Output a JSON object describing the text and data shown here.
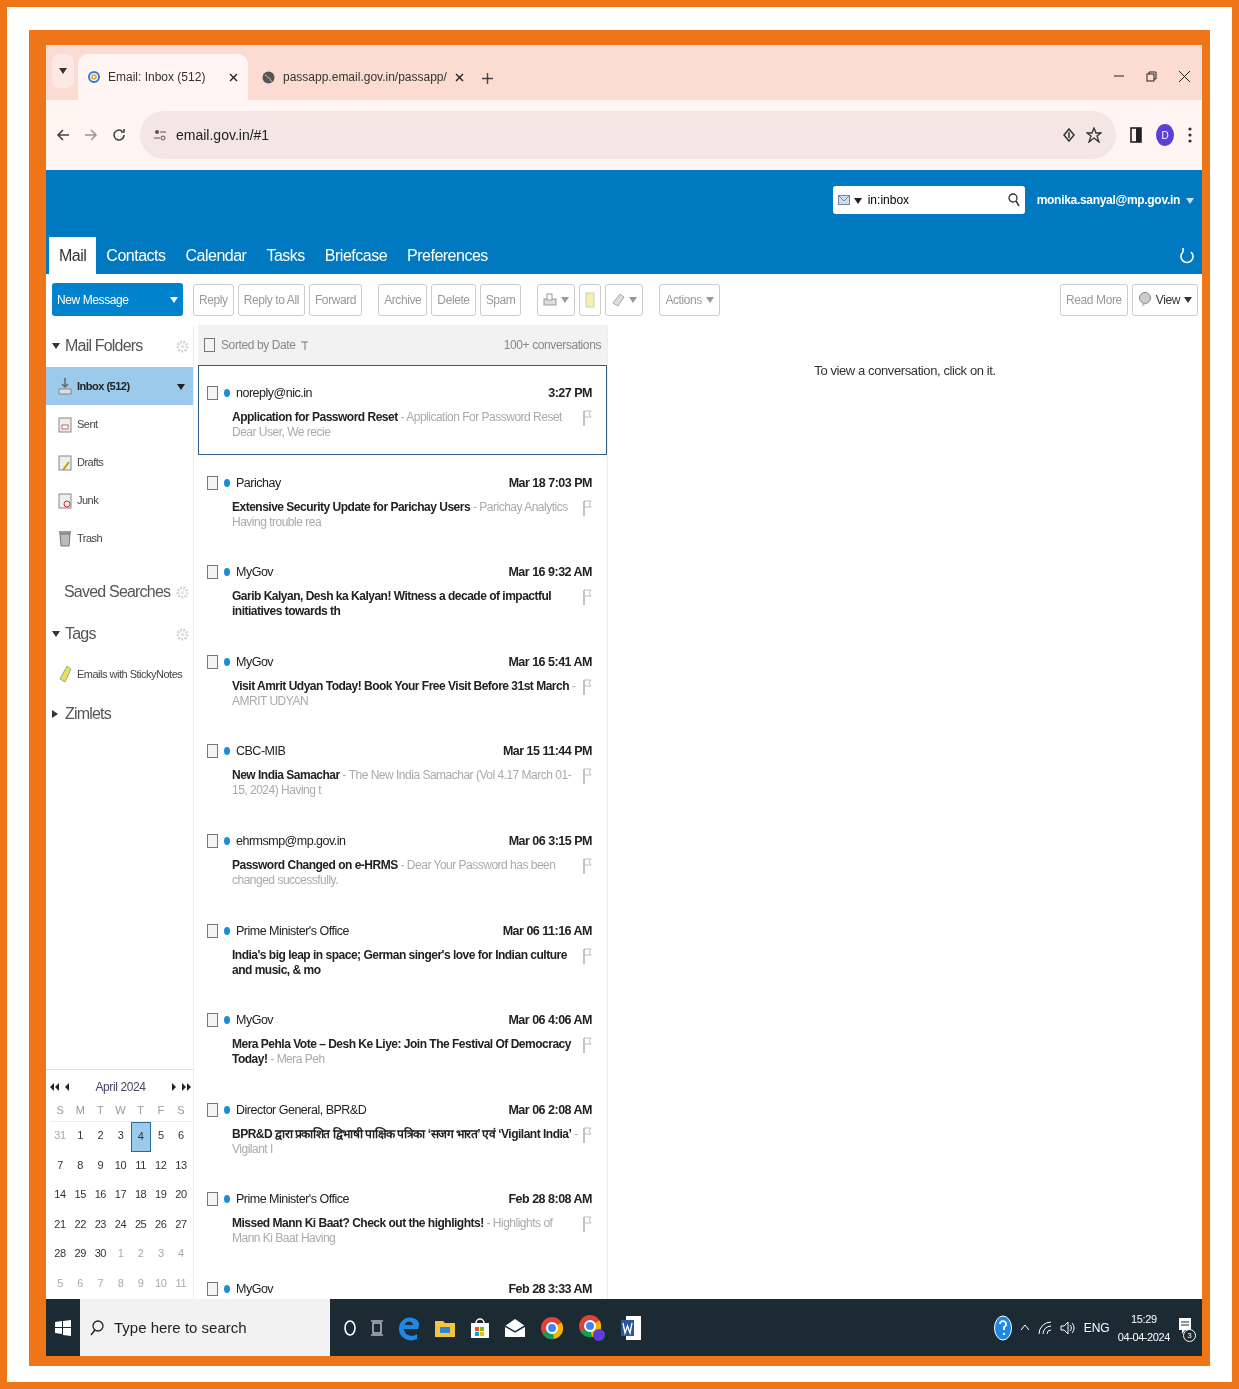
{
  "browser": {
    "tabs": [
      {
        "title": "Email: Inbox (512)",
        "selected": true
      },
      {
        "title": "passapp.email.gov.in/passapp/",
        "selected": false
      }
    ],
    "address": "email.gov.in/#1",
    "profile_initial": "D"
  },
  "header": {
    "search": {
      "value": "in:inbox"
    },
    "user": "monika.sanyal@mp.gov.in"
  },
  "app_tabs": [
    {
      "label": "Mail",
      "selected": true
    },
    {
      "label": "Contacts",
      "selected": false
    },
    {
      "label": "Calendar",
      "selected": false
    },
    {
      "label": "Tasks",
      "selected": false
    },
    {
      "label": "Briefcase",
      "selected": false
    },
    {
      "label": "Preferences",
      "selected": false
    }
  ],
  "toolbar": {
    "new_message": "New Message",
    "buttons": [
      "Reply",
      "Reply to All",
      "Forward",
      "Archive",
      "Delete",
      "Spam"
    ],
    "actions": "Actions",
    "read_more": "Read More",
    "view": "View"
  },
  "sidebar": {
    "sections": [
      {
        "title": "Mail Folders",
        "kind": "tree",
        "expanded": true,
        "items": [
          {
            "label": "Inbox (512)",
            "selected": true
          },
          {
            "label": "Sent",
            "selected": false
          },
          {
            "label": "Drafts",
            "selected": false
          },
          {
            "label": "Junk",
            "selected": false
          },
          {
            "label": "Trash",
            "selected": false
          }
        ]
      },
      {
        "title": "Saved Searches",
        "kind": "plain"
      },
      {
        "title": "Tags",
        "kind": "tree",
        "expanded": true,
        "items": [
          {
            "label": "Emails with StickyNotes",
            "selected": false
          }
        ]
      },
      {
        "title": "Zimlets",
        "kind": "tree",
        "expanded": false
      }
    ]
  },
  "calendar": {
    "month": "April 2024",
    "weekdays": [
      "S",
      "M",
      "T",
      "W",
      "T",
      "F",
      "S"
    ],
    "weeks": [
      [
        {
          "d": "31",
          "other": true,
          "selected": false
        },
        {
          "d": "1",
          "other": false,
          "selected": false
        },
        {
          "d": "2",
          "other": false,
          "selected": false
        },
        {
          "d": "3",
          "other": false,
          "selected": false
        },
        {
          "d": "4",
          "other": false,
          "selected": true
        },
        {
          "d": "5",
          "other": false,
          "selected": false
        },
        {
          "d": "6",
          "other": false,
          "selected": false
        }
      ],
      [
        {
          "d": "7",
          "other": false,
          "selected": false
        },
        {
          "d": "8",
          "other": false,
          "selected": false
        },
        {
          "d": "9",
          "other": false,
          "selected": false
        },
        {
          "d": "10",
          "other": false,
          "selected": false
        },
        {
          "d": "11",
          "other": false,
          "selected": false
        },
        {
          "d": "12",
          "other": false,
          "selected": false
        },
        {
          "d": "13",
          "other": false,
          "selected": false
        }
      ],
      [
        {
          "d": "14",
          "other": false,
          "selected": false
        },
        {
          "d": "15",
          "other": false,
          "selected": false
        },
        {
          "d": "16",
          "other": false,
          "selected": false
        },
        {
          "d": "17",
          "other": false,
          "selected": false
        },
        {
          "d": "18",
          "other": false,
          "selected": false
        },
        {
          "d": "19",
          "other": false,
          "selected": false
        },
        {
          "d": "20",
          "other": false,
          "selected": false
        }
      ],
      [
        {
          "d": "21",
          "other": false,
          "selected": false
        },
        {
          "d": "22",
          "other": false,
          "selected": false
        },
        {
          "d": "23",
          "other": false,
          "selected": false
        },
        {
          "d": "24",
          "other": false,
          "selected": false
        },
        {
          "d": "25",
          "other": false,
          "selected": false
        },
        {
          "d": "26",
          "other": false,
          "selected": false
        },
        {
          "d": "27",
          "other": false,
          "selected": false
        }
      ],
      [
        {
          "d": "28",
          "other": false,
          "selected": false
        },
        {
          "d": "29",
          "other": false,
          "selected": false
        },
        {
          "d": "30",
          "other": false,
          "selected": false
        },
        {
          "d": "1",
          "other": true,
          "selected": false
        },
        {
          "d": "2",
          "other": true,
          "selected": false
        },
        {
          "d": "3",
          "other": true,
          "selected": false
        },
        {
          "d": "4",
          "other": true,
          "selected": false
        }
      ],
      [
        {
          "d": "5",
          "other": true,
          "selected": false
        },
        {
          "d": "6",
          "other": true,
          "selected": false
        },
        {
          "d": "7",
          "other": true,
          "selected": false
        },
        {
          "d": "8",
          "other": true,
          "selected": false
        },
        {
          "d": "9",
          "other": true,
          "selected": false
        },
        {
          "d": "10",
          "other": true,
          "selected": false
        },
        {
          "d": "11",
          "other": true,
          "selected": false
        }
      ]
    ]
  },
  "list": {
    "all_checked": false,
    "sort": "Sorted by Date",
    "count": "100+ conversations",
    "messages": [
      {
        "sender": "noreply@nic.in",
        "time": "3:27 PM",
        "subject": "Application for Password Reset",
        "snippet": "- Application For Password Reset Dear User, We recie",
        "checked": false,
        "selected": true
      },
      {
        "sender": "Parichay",
        "time": "Mar 18 7:03 PM",
        "subject": "Extensive Security Update for Parichay Users",
        "snippet": "- Parichay Analytics Having trouble rea",
        "checked": false,
        "selected": false
      },
      {
        "sender": "MyGov",
        "time": "Mar 16 9:32 AM",
        "subject": "Garib Kalyan, Desh ka Kalyan! Witness a decade of impactful initiatives towards th",
        "checked": false,
        "selected": false
      },
      {
        "sender": "MyGov",
        "time": "Mar 16 5:41 AM",
        "subject": "Visit Amrit Udyan Today! Book Your Free Visit Before 31st March",
        "snippet": "- AMRIT UDYAN",
        "checked": false,
        "selected": false
      },
      {
        "sender": "CBC-MIB",
        "time": "Mar 15 11:44 PM",
        "subject": "New India Samachar",
        "snippet": "- The New India Samachar (Vol 4.17 March 01-15, 2024) Having t",
        "checked": false,
        "selected": false
      },
      {
        "sender": "ehrmsmp@mp.gov.in",
        "time": "Mar 06 3:15 PM",
        "subject": "Password Changed on e-HRMS",
        "snippet": "- Dear Your Password has been changed successfully.",
        "checked": false,
        "selected": false
      },
      {
        "sender": "Prime Minister's Office",
        "time": "Mar 06 11:16 AM",
        "subject": "India's big leap in space; German singer's love for Indian culture and music, & mo",
        "checked": false,
        "selected": false
      },
      {
        "sender": "MyGov",
        "time": "Mar 06 4:06 AM",
        "subject": "Mera Pehla Vote – Desh Ke Liye: Join The Festival Of Democracy Today!",
        "snippet": "- Mera Peh",
        "checked": false,
        "selected": false
      },
      {
        "sender": "Director General, BPR&D",
        "time": "Mar 06 2:08 AM",
        "subject": "BPR&D द्वारा प्रकाशित द्विभाषी पाक्षिक पत्रिका ‘सजग भारत’ एवं ‘Vigilant India’",
        "snippet": "- Vigilant I",
        "checked": false,
        "selected": false
      },
      {
        "sender": "Prime Minister's Office",
        "time": "Feb 28 8:08 AM",
        "subject": "Missed Mann Ki Baat? Check out the highlights!",
        "snippet": "- Highlights of Mann Ki Baat Having",
        "checked": false,
        "selected": false
      },
      {
        "sender": "MyGov",
        "time": "Feb 28 3:33 AM",
        "checked": false,
        "selected": false
      }
    ]
  },
  "reading_pane": {
    "hint": "To view a conversation, click on it."
  },
  "taskbar": {
    "search_placeholder": "Type here to search",
    "language": "ENG",
    "time": "15:29",
    "date": "04-04-2024",
    "notifications": "3"
  }
}
